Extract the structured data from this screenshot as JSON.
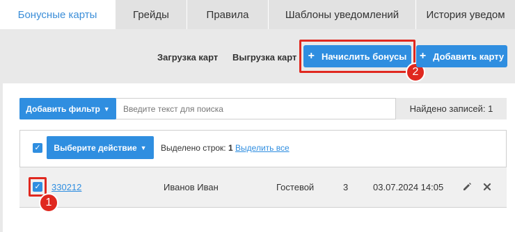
{
  "tabs": [
    {
      "label": "Бонусные карты",
      "active": true
    },
    {
      "label": "Грейды",
      "active": false
    },
    {
      "label": "Правила",
      "active": false
    },
    {
      "label": "Шаблоны уведомлений",
      "active": false
    },
    {
      "label": "История уведом",
      "active": false
    }
  ],
  "toolbar": {
    "upload_cards": "Загрузка карт",
    "download_cards": "Выгрузка карт",
    "accrue_bonuses": "Начислить бонусы",
    "add_card": "Добавить карту"
  },
  "filter": {
    "add_filter": "Добавить фильтр",
    "search_placeholder": "Введите текст для поиска",
    "found_records": "Найдено записей: 1"
  },
  "actions": {
    "select_action": "Выберите действие",
    "rows_selected_label": "Выделено строк:",
    "rows_selected_count": "1",
    "select_all": "Выделить все"
  },
  "rows": [
    {
      "card_number": "330212",
      "name": "Иванов Иван",
      "grade": "Гостевой",
      "count": "3",
      "date": "03.07.2024 14:05",
      "checked": true
    }
  ],
  "annotations": {
    "badge_1": "1",
    "badge_2": "2"
  },
  "colors": {
    "accent": "#2f8ee0",
    "highlight": "#e0281f"
  }
}
